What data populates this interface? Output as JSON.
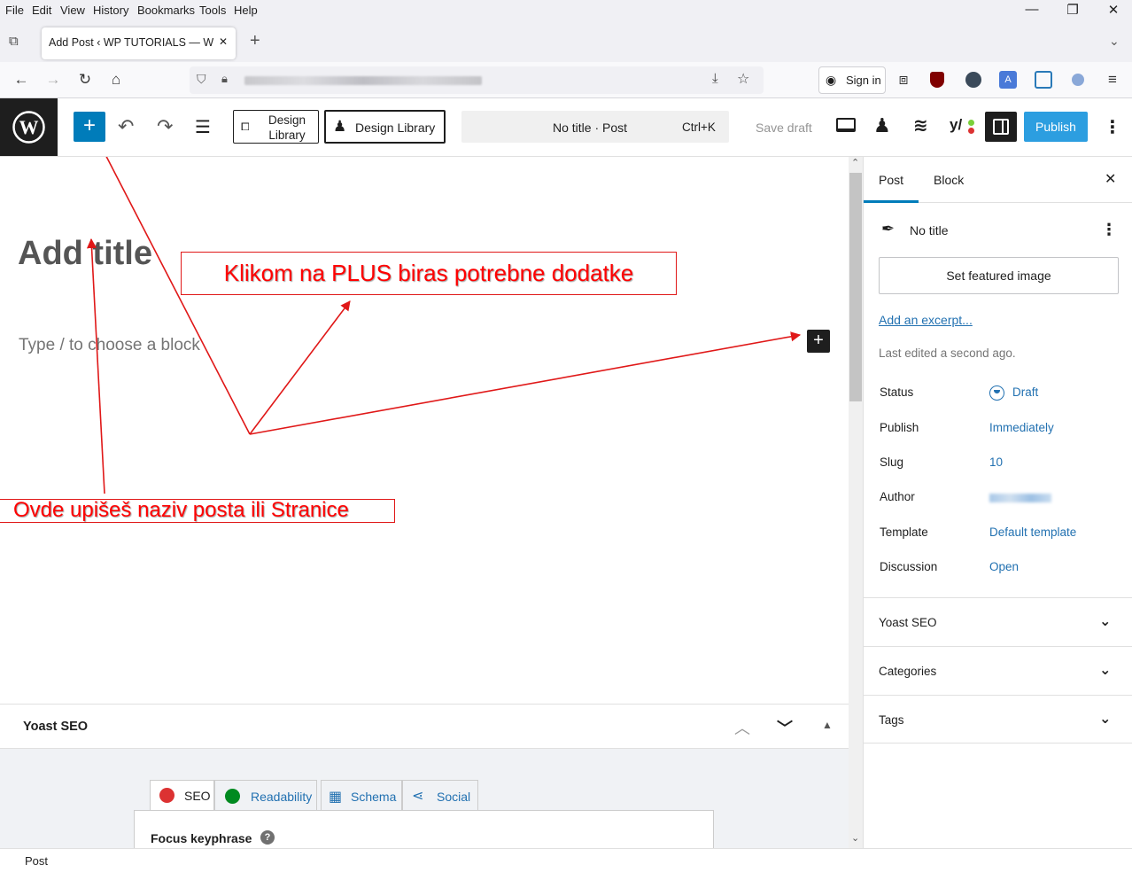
{
  "browser": {
    "menu": [
      "File",
      "Edit",
      "View",
      "History",
      "Bookmarks",
      "Tools",
      "Help"
    ],
    "tab_title": "Add Post ‹ WP TUTORIALS — WordPress",
    "sign_in": "Sign in"
  },
  "toolbar": {
    "design_library_1": "Design Library",
    "design_library_2": "Design Library",
    "doc_title": "No title · Post",
    "shortcut": "Ctrl+K",
    "save_draft": "Save draft",
    "publish": "Publish"
  },
  "editor": {
    "title_placeholder": "Add title",
    "block_placeholder": "Type / to choose a block"
  },
  "annotations": {
    "plus_note": "Klikom na PLUS biras potrebne dodatke",
    "title_note": "Ovde upišeš naziv posta ili Stranice"
  },
  "sidebar": {
    "tab_post": "Post",
    "tab_block": "Block",
    "post_name": "No title",
    "featured_image": "Set featured image",
    "excerpt": "Add an excerpt...",
    "last_edited": "Last edited a second ago.",
    "rows": [
      {
        "label": "Status",
        "value": "Draft"
      },
      {
        "label": "Publish",
        "value": "Immediately"
      },
      {
        "label": "Slug",
        "value": "10"
      },
      {
        "label": "Author",
        "value": ""
      },
      {
        "label": "Template",
        "value": "Default template"
      },
      {
        "label": "Discussion",
        "value": "Open"
      }
    ],
    "panels": [
      "Yoast SEO",
      "Categories",
      "Tags"
    ]
  },
  "yoast": {
    "title": "Yoast SEO",
    "tabs": [
      "SEO",
      "Readability",
      "Schema",
      "Social"
    ],
    "focus_keyphrase": "Focus keyphrase"
  },
  "statusbar": {
    "breadcrumb": "Post"
  },
  "colors": {
    "wp_blue": "#007cba",
    "publish_blue": "#2c9ee0",
    "link_blue": "#2271b1",
    "annotation_red": "#ff0000"
  }
}
